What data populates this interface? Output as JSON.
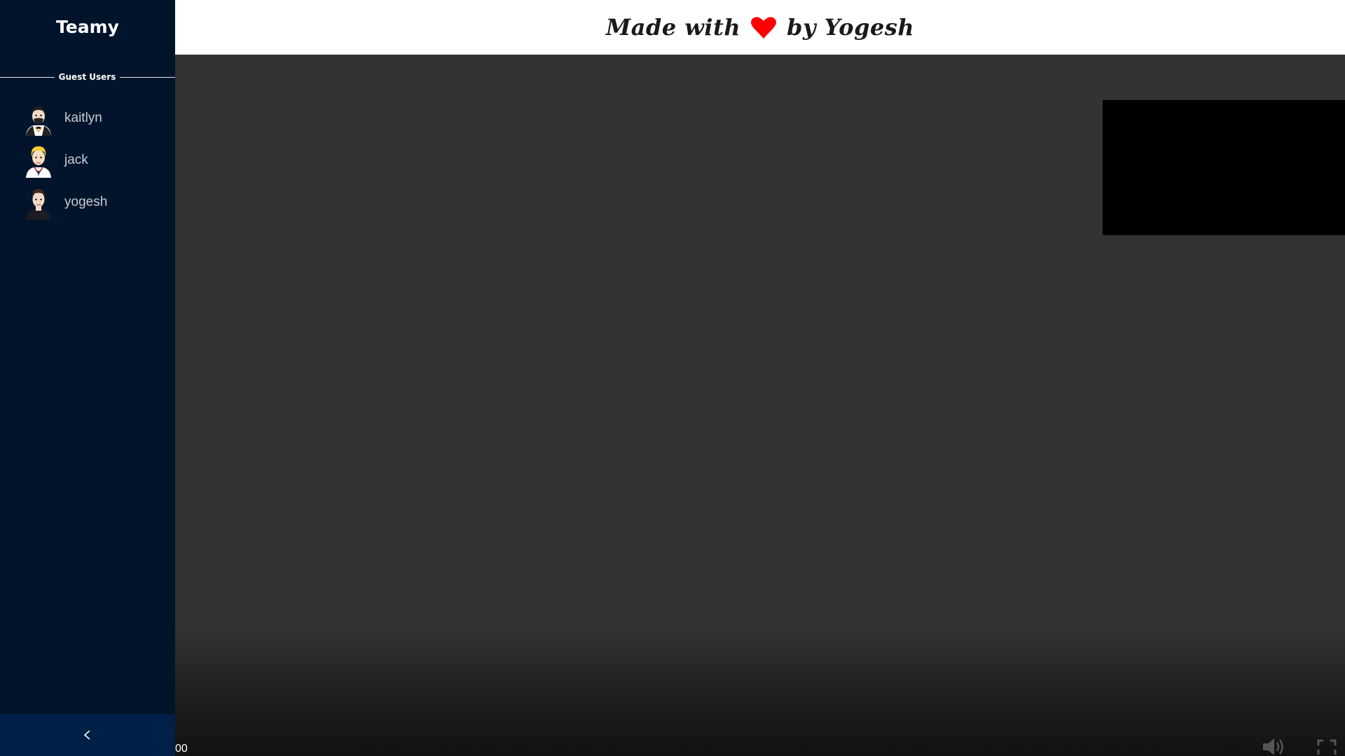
{
  "sidebar": {
    "brand": "Teamy",
    "section_label": "Guest Users",
    "users": [
      {
        "name": "kaitlyn",
        "avatar_icon": "avatar-mustache-man-icon"
      },
      {
        "name": "jack",
        "avatar_icon": "avatar-blonde-man-icon"
      },
      {
        "name": "yogesh",
        "avatar_icon": "avatar-dark-hair-man-icon"
      }
    ],
    "collapse_label": "<"
  },
  "header": {
    "credit_prefix": "Made with",
    "credit_suffix": "by Yogesh",
    "heart_icon": "heart-icon",
    "heart_color": "#ff0000"
  },
  "player": {
    "time": "00",
    "mute_icon": "volume-icon",
    "fullscreen_icon": "fullscreen-icon"
  },
  "colors": {
    "sidebar_bg": "#01142b",
    "stage_bg": "#333333",
    "collapse_bg": "#002147"
  }
}
